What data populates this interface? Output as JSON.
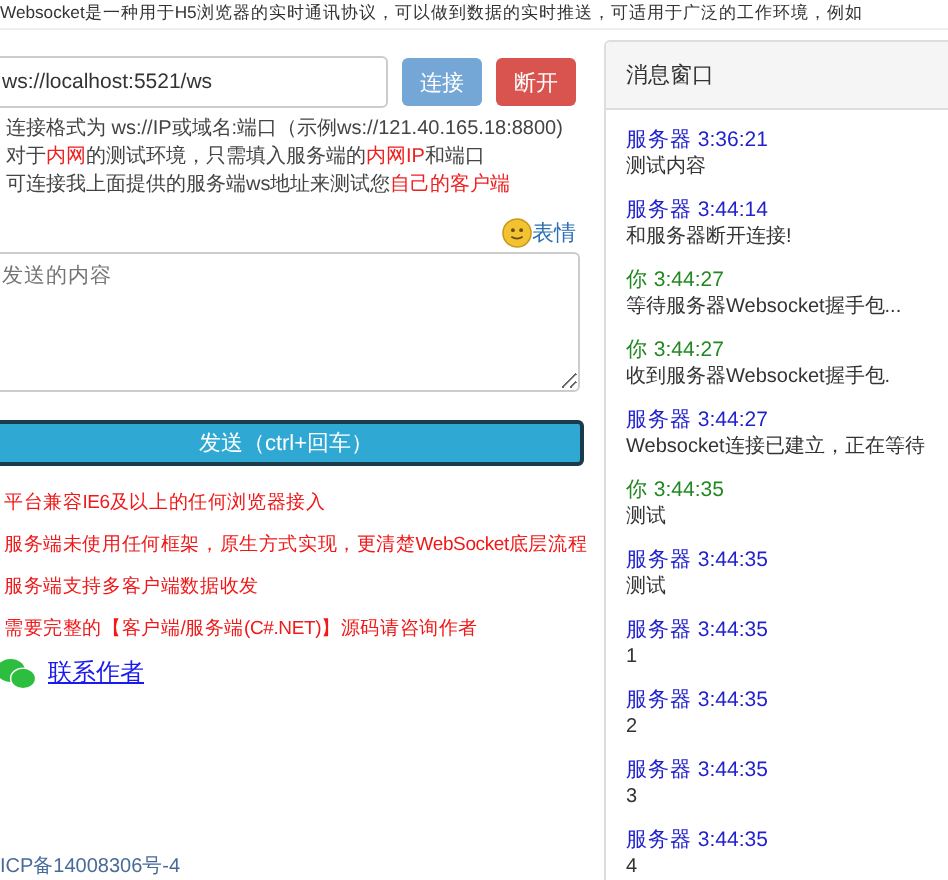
{
  "intro": "Websocket是一种用于H5浏览器的实时通讯协议，可以做到数据的实时推送，可适用于广泛的工作环境，例如",
  "connect": {
    "url": "ws://localhost:5521/ws",
    "connect_button": "连接",
    "disconnect_button": "断开"
  },
  "hints": [
    [
      {
        "text": "连接格式为 ws://IP或域名:端口（示例ws://121.40.165.18:8800)",
        "highlight": false
      }
    ],
    [
      {
        "text": "对于",
        "highlight": false
      },
      {
        "text": "内网",
        "highlight": true
      },
      {
        "text": "的测试环境，只需填入服务端的",
        "highlight": false
      },
      {
        "text": "内网IP",
        "highlight": true
      },
      {
        "text": "和端口",
        "highlight": false
      }
    ],
    [
      {
        "text": "可连接我上面提供的服务端ws地址来测试您",
        "highlight": false
      },
      {
        "text": "自己的客户端",
        "highlight": true
      }
    ]
  ],
  "emoji_link": "表情",
  "message_field": {
    "placeholder": "发送的内容"
  },
  "send_button": "发送（ctrl+回车）",
  "notes": [
    "平台兼容IE6及以上的任何浏览器接入",
    "服务端未使用任何框架，原生方式实现，更清楚WebSocket底层流程",
    "服务端支持多客户端数据收发",
    "需要完整的【客户端/服务端(C#.NET)】源码请咨询作者"
  ],
  "contact_link": "联系作者",
  "footer": "ICP备14008306号-4",
  "message_panel": {
    "title": "消息窗口",
    "messages": [
      {
        "kind": "server",
        "sender": "服务器",
        "time": "3:36:21",
        "text": "测试内容"
      },
      {
        "kind": "server",
        "sender": "服务器",
        "time": "3:44:14",
        "text": "和服务器断开连接!"
      },
      {
        "kind": "you",
        "sender": "你",
        "time": "3:44:27",
        "text": "等待服务器Websocket握手包..."
      },
      {
        "kind": "you",
        "sender": "你",
        "time": "3:44:27",
        "text": "收到服务器Websocket握手包."
      },
      {
        "kind": "server",
        "sender": "服务器",
        "time": "3:44:27",
        "text": "Websocket连接已建立，正在等待"
      },
      {
        "kind": "you",
        "sender": "你",
        "time": "3:44:35",
        "text": "测试"
      },
      {
        "kind": "server",
        "sender": "服务器",
        "time": "3:44:35",
        "text": "测试"
      },
      {
        "kind": "server",
        "sender": "服务器",
        "time": "3:44:35",
        "text": "1"
      },
      {
        "kind": "server",
        "sender": "服务器",
        "time": "3:44:35",
        "text": "2"
      },
      {
        "kind": "server",
        "sender": "服务器",
        "time": "3:44:35",
        "text": "3"
      },
      {
        "kind": "server",
        "sender": "服务器",
        "time": "3:44:35",
        "text": "4"
      }
    ]
  }
}
